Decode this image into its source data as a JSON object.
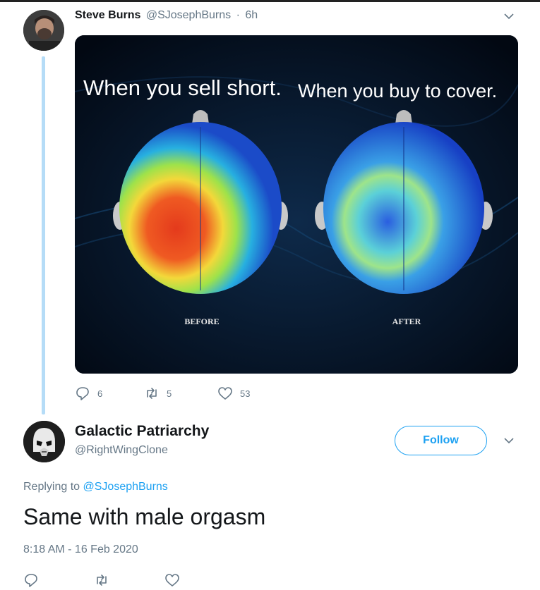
{
  "tweet1": {
    "display_name": "Steve Burns",
    "handle": "@SJosephBurns",
    "separator": "·",
    "time": "6h",
    "media": {
      "caption_left": "When you sell short.",
      "caption_right": "When you buy to cover.",
      "label_left": "BEFORE",
      "label_right": "AFTER"
    },
    "replies": "6",
    "retweets": "5",
    "likes": "53"
  },
  "tweet2": {
    "display_name": "Galactic Patriarchy",
    "handle": "@RightWingClone",
    "follow_label": "Follow",
    "replying_prefix": "Replying to",
    "replying_mention": "@SJosephBurns",
    "text": "Same with male orgasm",
    "timestamp": "8:18 AM - 16 Feb 2020"
  },
  "icons": {
    "reply": "reply-icon",
    "retweet": "retweet-icon",
    "like": "heart-icon",
    "more": "chevron-down-icon"
  },
  "colors": {
    "accent": "#1da1f2",
    "secondary_text": "#657786",
    "thread_line": "#b5dcf7"
  }
}
